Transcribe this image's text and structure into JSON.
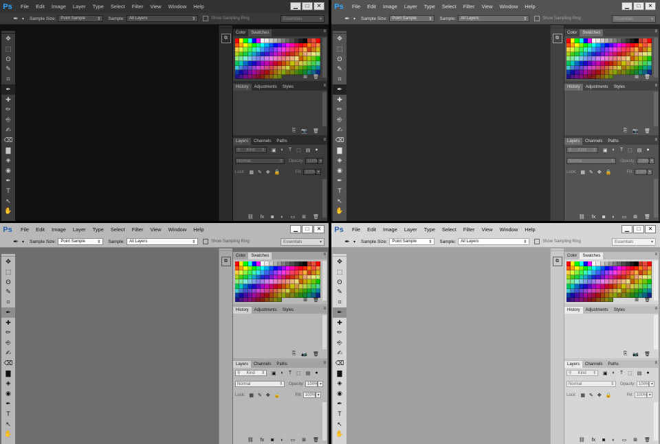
{
  "app": {
    "logo": "Ps"
  },
  "menu": [
    "File",
    "Edit",
    "Image",
    "Layer",
    "Type",
    "Select",
    "Filter",
    "View",
    "Window",
    "Help"
  ],
  "window_controls": {
    "minimize": "▁",
    "restore": "□",
    "close": "✕"
  },
  "options_bar": {
    "tool_icon": "eyedropper-icon",
    "sample_size_label": "Sample Size:",
    "sample_size_value": "Point Sample",
    "sample_label": "Sample:",
    "sample_value": "All Layers",
    "sampling_ring_label": "Show Sampling Ring",
    "workspace": "Essentials"
  },
  "color_panel": {
    "tabs": [
      "Color",
      "Swatches"
    ],
    "active_tab": "Swatches"
  },
  "history_panel": {
    "tabs": [
      "History",
      "Adjustments",
      "Styles"
    ],
    "active_tab": "History"
  },
  "layers_panel": {
    "tabs": [
      "Layers",
      "Channels",
      "Paths"
    ],
    "active_tab": "Layers",
    "filter_placeholder": "Kind",
    "blend_mode": "Normal",
    "opacity_label": "Opacity:",
    "opacity_value": "100%",
    "lock_label": "Lock:",
    "fill_label": "Fill:",
    "fill_value": "100%"
  },
  "themes": [
    {
      "id": "darkest"
    },
    {
      "id": "dark"
    },
    {
      "id": "medium"
    },
    {
      "id": "light"
    }
  ]
}
